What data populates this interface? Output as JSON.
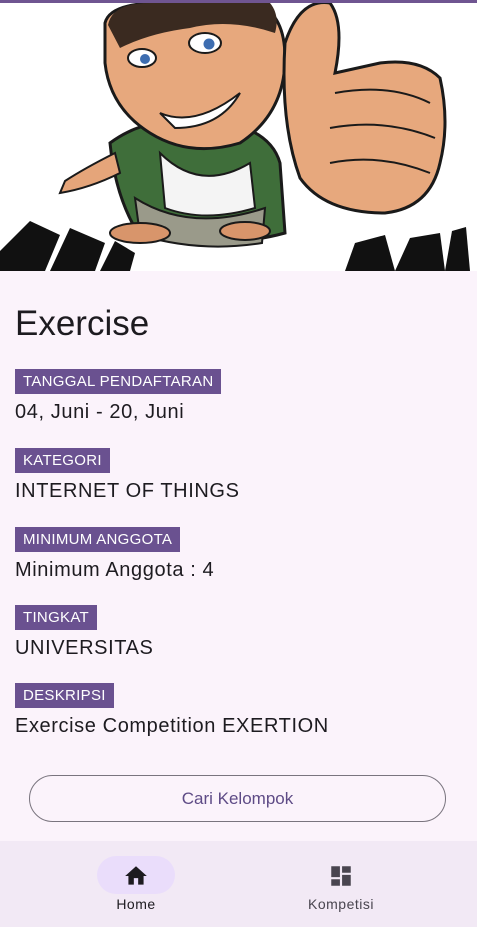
{
  "hero": {
    "image_icon": "cartoon-thumbs-up-image"
  },
  "competition": {
    "title": "Exercise",
    "fields": [
      {
        "label": "TANGGAL PENDAFTARAN",
        "value": "04, Juni - 20, Juni"
      },
      {
        "label": "KATEGORI",
        "value": "INTERNET OF THINGS"
      },
      {
        "label": "MINIMUM ANGGOTA",
        "value": "Minimum Anggota : 4"
      },
      {
        "label": "TINGKAT",
        "value": "UNIVERSITAS"
      },
      {
        "label": "DESKRIPSI",
        "value": "Exercise Competition EXERTION"
      }
    ],
    "cta_label": "Cari Kelompok"
  },
  "bottom_nav": {
    "items": [
      {
        "label": "Home",
        "icon": "home-icon",
        "active": true
      },
      {
        "label": "Kompetisi",
        "icon": "dashboard-icon",
        "active": false
      }
    ]
  },
  "colors": {
    "accent": "#6a5190",
    "background": "#fbf3fb",
    "nav_background": "#f2e9f5",
    "active_pill": "#eaddfb"
  }
}
